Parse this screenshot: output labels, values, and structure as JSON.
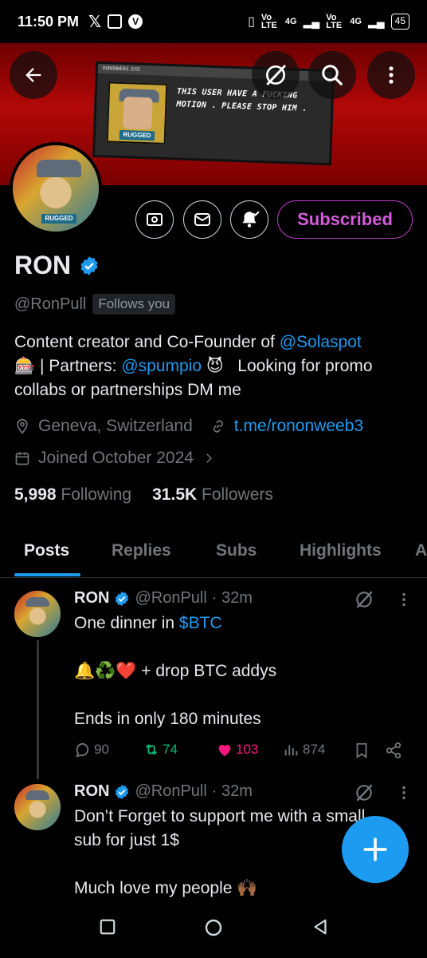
{
  "status_bar": {
    "time": "11:50 PM",
    "icons": [
      "x-logo-icon",
      "activity-icon",
      "v-badge-icon"
    ],
    "signal_text_1": "Vo LTE",
    "network_1": "4G",
    "signal_text_2": "Vo LTE",
    "network_2": "4G",
    "battery": "45"
  },
  "banner": {
    "window_title": "RONONWEB3.EXE",
    "art_label": "RUGGED",
    "message": "THIS USER HAVE A FUCKING MOTION . PLEASE STOP HIM ."
  },
  "profile": {
    "name": "RON",
    "handle": "@RonPull",
    "follows_badge": "Follows you",
    "subscribe_label": "Subscribed",
    "avatar_label": "RUGGED",
    "bio": {
      "line1_text": "Content creator and Co-Founder of ",
      "line1_link": "@Solaspot",
      "line2_emoji": "🎰",
      "line2_text": " | Partners: ",
      "line2_link": "@spumpio",
      "line2_emoji2": "😈",
      "line2_after": "   Looking for promo",
      "line3_text": "collabs or partnerships DM me"
    },
    "location": "Geneva, Switzerland",
    "website": "t.me/rononweeb3",
    "joined": "Joined October 2024",
    "following_count": "5,998",
    "following_label": "Following",
    "followers_count": "31.5K",
    "followers_label": "Followers"
  },
  "tabs": [
    "Posts",
    "Replies",
    "Subs",
    "Highlights",
    "A"
  ],
  "posts": [
    {
      "name": "RON",
      "handle": "@RonPull",
      "time": "· 32m",
      "line1_text": "One dinner in ",
      "line1_link": "$BTC",
      "line2": "🔔♻️❤️ + drop BTC addys",
      "line3": "Ends in only 180 minutes",
      "replies": "90",
      "reposts": "74",
      "likes": "103",
      "views": "874"
    },
    {
      "name": "RON",
      "handle": "@RonPull",
      "time": "· 32m",
      "line1": "Don’t Forget to support me with a small",
      "line2": "sub for just 1$",
      "line3": "Much love my people 🙌🏾"
    }
  ],
  "colors": {
    "accent": "#1d9bf0",
    "subscribe": "#c13bc9",
    "like": "#f91880",
    "repost": "#00ba7c",
    "banner": "#b30808"
  }
}
